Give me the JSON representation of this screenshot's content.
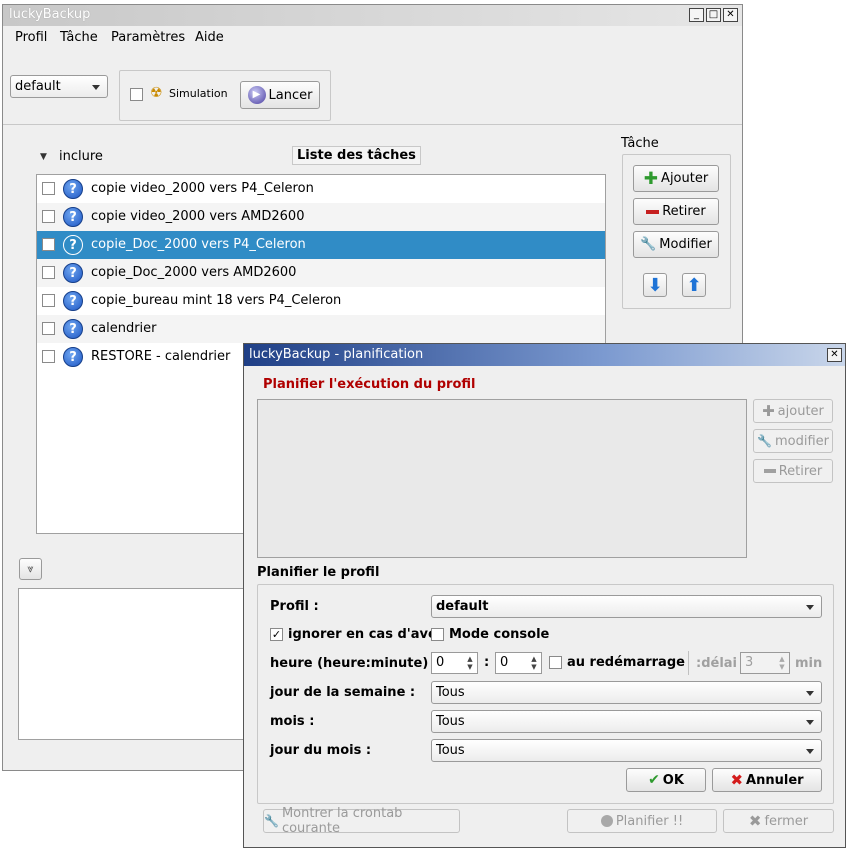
{
  "main_window": {
    "title": "luckyBackup",
    "controls": {
      "minimize": "_",
      "maximize": "□",
      "close": "✕"
    },
    "menu": [
      "Profil",
      "Tâche",
      "Paramètres",
      "Aide"
    ],
    "profile_select": "default",
    "simulation_label": "Simulation",
    "run_label": "Lancer",
    "include_label": "inclure",
    "task_list_title": "Liste des tâches",
    "task_group_title": "Tâche",
    "add_label": "Ajouter",
    "remove_label": "Retirer",
    "modify_label": "Modifier",
    "tasks": [
      {
        "label": "copie video_2000 vers P4_Celeron"
      },
      {
        "label": "copie video_2000 vers AMD2600"
      },
      {
        "label": "copie_Doc_2000 vers P4_Celeron"
      },
      {
        "label": "copie_Doc_2000 vers AMD2600"
      },
      {
        "label": "copie_bureau mint 18 vers P4_Celeron"
      },
      {
        "label": "calendrier"
      },
      {
        "label": "RESTORE - calendrier"
      }
    ]
  },
  "dialog": {
    "title": "luckyBackup - planification",
    "close": "✕",
    "heading": "Planifier l'exécution du profil",
    "side_add": "ajouter",
    "side_modify": "modifier",
    "side_remove": "Retirer",
    "section_title": "Planifier le profil",
    "profile_label": "Profil :",
    "profile_value": "default",
    "ignore_label": "ignorer en cas d'ave",
    "console_label": "Mode console",
    "time_label": "heure (heure:minute) :",
    "hour_value": "0",
    "colon": ":",
    "minute_value": "0",
    "reboot_label": "au redémarrage",
    "delay_label": ":délai",
    "delay_value": "3",
    "min_label": "min",
    "weekday_label": "jour de la semaine :",
    "weekday_value": "Tous",
    "month_label": "mois :",
    "month_value": "Tous",
    "monthday_label": "jour du mois :",
    "monthday_value": "Tous",
    "ok_label": "OK",
    "cancel_label": "Annuler",
    "crontab_label": "Montrer la crontab courante",
    "schedule_label": "Planifier !!",
    "close_label": "fermer"
  }
}
